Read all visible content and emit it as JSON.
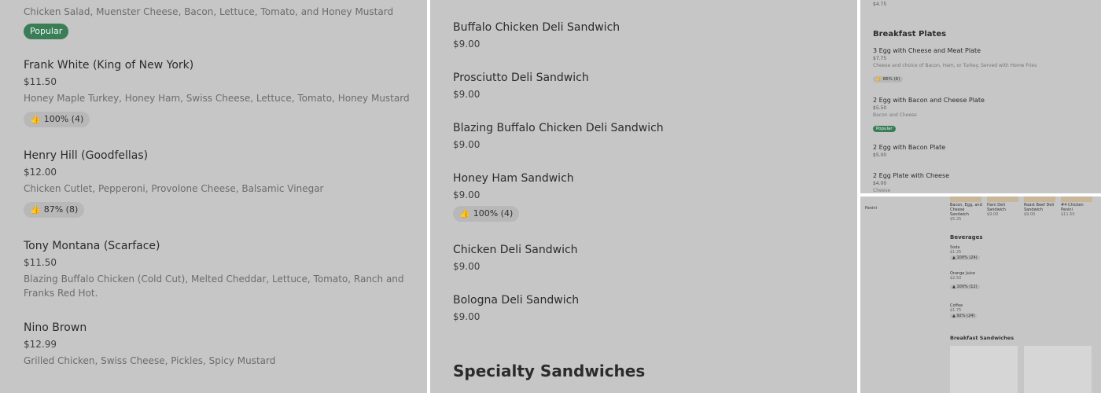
{
  "panel_left": {
    "top_desc": "Chicken Salad, Muenster Cheese, Bacon, Lettuce, Tomato, and Honey Mustard",
    "top_badge": "Popular",
    "items": [
      {
        "name": "Frank White (King of New York)",
        "price": "$11.50",
        "desc": "Honey Maple Turkey, Honey Ham, Swiss Cheese, Lettuce, Tomato, Honey Mustard",
        "rating": "100% (4)"
      },
      {
        "name": "Henry Hill (Goodfellas)",
        "price": "$12.00",
        "desc": "Chicken Cutlet, Pepperoni, Provolone Cheese, Balsamic Vinegar",
        "rating": "87% (8)"
      },
      {
        "name": "Tony Montana (Scarface)",
        "price": "$11.50",
        "desc": "Blazing Buffalo Chicken (Cold Cut), Melted Cheddar, Lettuce, Tomato, Ranch and Franks Red Hot."
      },
      {
        "name": "Nino Brown",
        "price": "$12.99",
        "desc": "Grilled Chicken, Swiss Cheese, Pickles, Spicy Mustard"
      }
    ]
  },
  "panel_middle": {
    "items": [
      {
        "name": "Buffalo Chicken Deli Sandwich",
        "price": "$9.00"
      },
      {
        "name": "Prosciutto Deli Sandwich",
        "price": "$9.00"
      },
      {
        "name": "Blazing Buffalo Chicken Deli Sandwich",
        "price": "$9.00"
      },
      {
        "name": "Honey Ham Sandwich",
        "price": "$9.00",
        "rating": "100% (4)"
      },
      {
        "name": "Chicken Deli Sandwich",
        "price": "$9.00"
      },
      {
        "name": "Bologna Deli Sandwich",
        "price": "$9.00"
      }
    ],
    "section_heading": "Specialty Sandwiches"
  },
  "panel_small_top": {
    "top_price": "$4.75",
    "heading": "Breakfast Plates",
    "items": [
      {
        "name": "3 Egg with Cheese and Meat Plate",
        "price": "$7.75",
        "desc": "Cheese and choice of Bacon, Ham, or Turkey. Served with Home Fries",
        "rating": "86% (6)"
      },
      {
        "name": "2 Egg with Bacon and Cheese Plate",
        "price": "$5.50",
        "desc": "Bacon and Cheese",
        "badge": "Popular"
      },
      {
        "name": "2 Egg with Bacon Plate",
        "price": "$5.00"
      },
      {
        "name": "2 Egg Plate with Cheese",
        "price": "$4.00",
        "desc": "Cheese"
      }
    ]
  },
  "panel_small_bottom": {
    "sidebar_item": "Panini",
    "thumbs": [
      {
        "name": "Bacon, Egg, and Cheese Sandwich",
        "price": "$5.25"
      },
      {
        "name": "Ham Deli Sandwich",
        "price": "$9.00"
      },
      {
        "name": "Roast Beef Deli Sandwich",
        "price": "$9.00"
      },
      {
        "name": "#4 Chicken Panini",
        "price": "$11.50"
      }
    ],
    "beverages_heading": "Beverages",
    "beverages": [
      {
        "name": "Soda",
        "price": "$1.25",
        "rating": "100% (24)"
      },
      {
        "name": "Orange Juice",
        "price": "$2.50",
        "rating": "100% (12)"
      },
      {
        "name": "Coffee",
        "price": "$1.75",
        "rating": "92% (24)"
      }
    ],
    "breakfast_heading": "Breakfast Sandwiches"
  }
}
